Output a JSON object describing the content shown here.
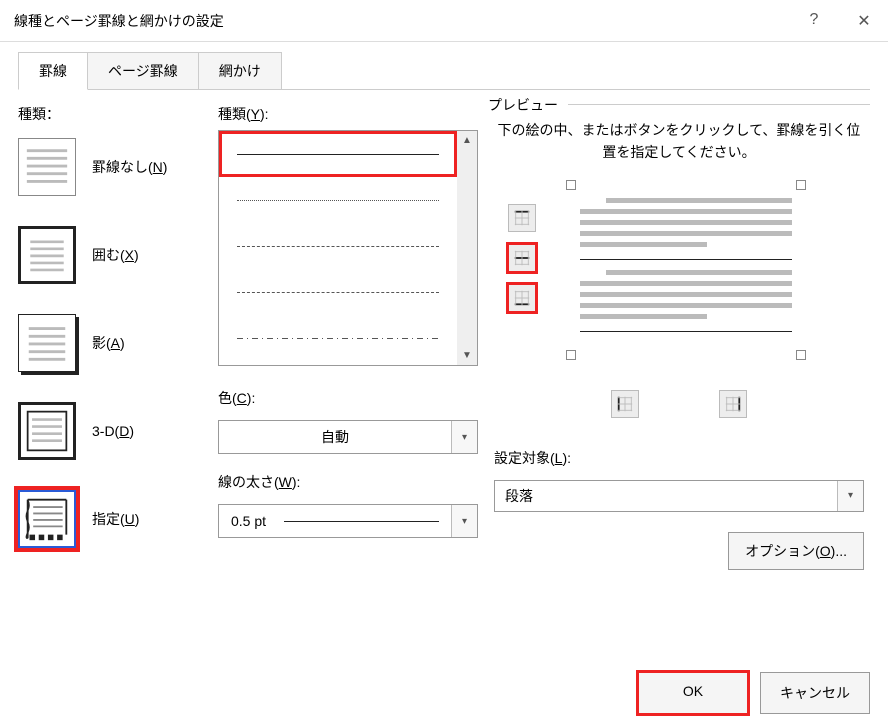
{
  "title": "線種とページ罫線と網かけの設定",
  "tabs": [
    "罫線",
    "ページ罫線",
    "網かけ"
  ],
  "active_tab": 0,
  "settings_label": "種類：",
  "settings": [
    {
      "label": "罫線なし(N)",
      "accel": "N"
    },
    {
      "label": "囲む(X)",
      "accel": "X"
    },
    {
      "label": "影(A)",
      "accel": "A"
    },
    {
      "label": "3-D(D)",
      "accel": "D"
    },
    {
      "label": "指定(U)",
      "accel": "U"
    }
  ],
  "style_label": "種類(Y):",
  "color_label": "色(C):",
  "color_value": "自動",
  "width_label": "線の太さ(W):",
  "width_value": "0.5 pt",
  "preview_label": "プレビュー",
  "preview_instr": "下の絵の中、またはボタンをクリックして、罫線を引く位置を指定してください。",
  "apply_label": "設定対象(L):",
  "apply_value": "段落",
  "options_btn": "オプション(O)...",
  "ok": "OK",
  "cancel": "キャンセル"
}
